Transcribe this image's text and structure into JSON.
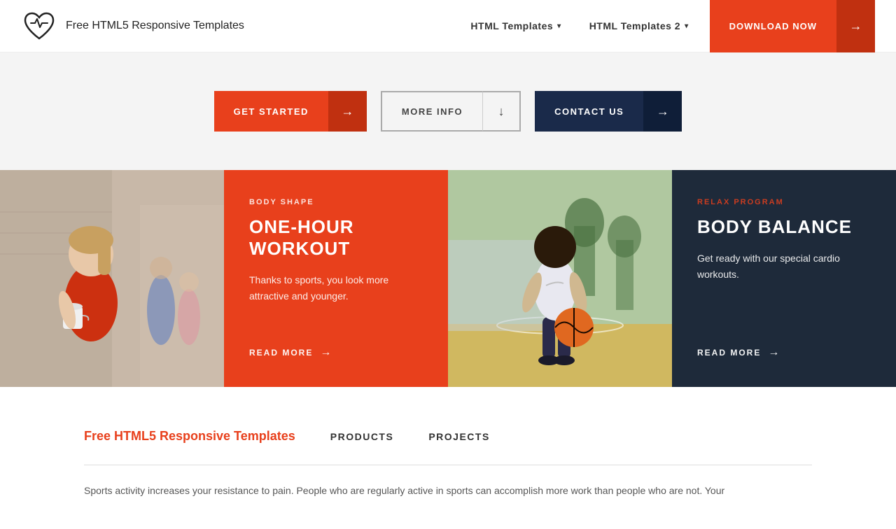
{
  "navbar": {
    "brand": "Free HTML5 Responsive Templates",
    "links": [
      {
        "label": "HTML Templates",
        "hasDropdown": true
      },
      {
        "label": "HTML Templates 2",
        "hasDropdown": true
      }
    ],
    "download_label": "DOWNLOAD NOW",
    "download_arrow": "→"
  },
  "hero": {
    "btn_get_started": "GET STARTED",
    "btn_more_info": "MORE INFO",
    "btn_contact": "CONTACT US",
    "arrow": "→",
    "down_arrow": "↓"
  },
  "cards": [
    {
      "type": "photo",
      "alt": "Woman at gym"
    },
    {
      "type": "content-red",
      "subtitle": "BODY SHAPE",
      "title": "ONE-HOUR WORKOUT",
      "desc": "Thanks to sports, you look more attractive and younger.",
      "readmore": "READ MORE"
    },
    {
      "type": "photo",
      "alt": "Man with basketball"
    },
    {
      "type": "content-dark",
      "subtitle": "RELAX PROGRAM",
      "title": "BODY BALANCE",
      "desc": "Get ready with our special cardio workouts.",
      "readmore": "READ MORE"
    }
  ],
  "bottom": {
    "brand": "Free HTML5 Responsive Templates",
    "links": [
      "PRODUCTS",
      "PROJECTS"
    ],
    "text": "Sports activity increases your resistance to pain. People who are regularly active in sports can accomplish more work than people who are not. Your"
  }
}
